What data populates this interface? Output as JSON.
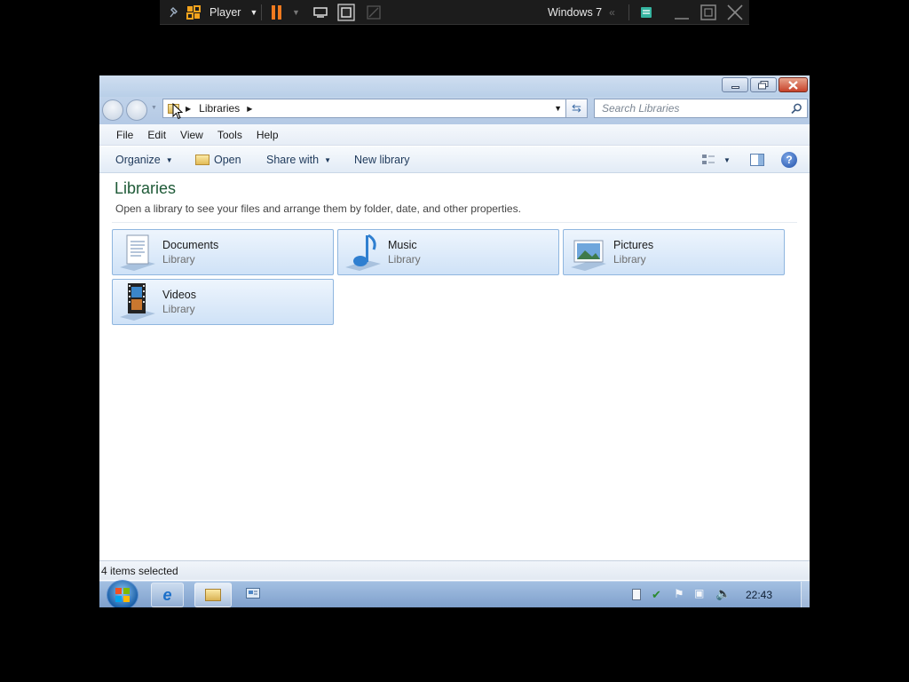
{
  "vm_bar": {
    "app_label": "Player",
    "vm_name": "Windows 7"
  },
  "explorer": {
    "breadcrumb": [
      "Libraries"
    ],
    "search_placeholder": "Search Libraries",
    "menu": [
      "File",
      "Edit",
      "View",
      "Tools",
      "Help"
    ],
    "commands": {
      "organize": "Organize",
      "open": "Open",
      "share_with": "Share with",
      "new_library": "New library"
    },
    "heading": "Libraries",
    "subheading": "Open a library to see your files and arrange them by folder, date, and other properties.",
    "libraries": [
      {
        "name": "Documents",
        "type": "Library",
        "icon": "documents-library-icon"
      },
      {
        "name": "Music",
        "type": "Library",
        "icon": "music-library-icon"
      },
      {
        "name": "Pictures",
        "type": "Library",
        "icon": "pictures-library-icon"
      },
      {
        "name": "Videos",
        "type": "Library",
        "icon": "videos-library-icon"
      }
    ],
    "status": "4 items selected"
  },
  "taskbar": {
    "clock": "22:43"
  },
  "colors": {
    "accent": "#1e5a37",
    "command_text": "#1e395b",
    "tile_border": "#8fb6df"
  }
}
